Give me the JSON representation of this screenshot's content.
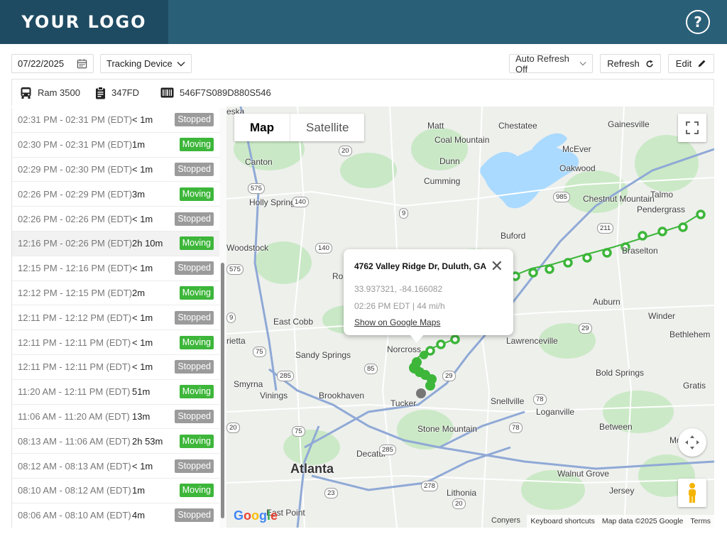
{
  "header": {
    "logo": "YOUR LOGO",
    "help_icon": "question-circle-icon",
    "help_label": "?"
  },
  "toolbar": {
    "date": "07/22/2025",
    "date_icon": "calendar-icon",
    "device": "Tracking Device",
    "auto_refresh": "Auto Refresh Off",
    "refresh_label": "Refresh",
    "edit_label": "Edit"
  },
  "vehicle": {
    "name": "Ram 3500",
    "plate": "347FD",
    "vin": "546F7S089D880S546"
  },
  "trips": [
    {
      "time": "02:31 PM - 02:31 PM (EDT)",
      "duration": "< 1m",
      "status": "Stopped"
    },
    {
      "time": "02:30 PM - 02:31 PM (EDT)",
      "duration": "1m",
      "status": "Moving"
    },
    {
      "time": "02:29 PM - 02:30 PM (EDT)",
      "duration": "< 1m",
      "status": "Stopped"
    },
    {
      "time": "02:26 PM - 02:29 PM (EDT)",
      "duration": "3m",
      "status": "Moving"
    },
    {
      "time": "02:26 PM - 02:26 PM (EDT)",
      "duration": "< 1m",
      "status": "Stopped"
    },
    {
      "time": "12:16 PM - 02:26 PM (EDT)",
      "duration": "2h 10m",
      "status": "Moving"
    },
    {
      "time": "12:15 PM - 12:16 PM (EDT)",
      "duration": "< 1m",
      "status": "Stopped"
    },
    {
      "time": "12:12 PM - 12:15 PM (EDT)",
      "duration": "2m",
      "status": "Moving"
    },
    {
      "time": "12:11 PM - 12:12 PM (EDT)",
      "duration": "< 1m",
      "status": "Stopped"
    },
    {
      "time": "12:11 PM - 12:11 PM (EDT)",
      "duration": "< 1m",
      "status": "Moving"
    },
    {
      "time": "12:11 PM - 12:11 PM (EDT)",
      "duration": "< 1m",
      "status": "Stopped"
    },
    {
      "time": "11:20 AM - 12:11 PM (EDT)",
      "duration": "51m",
      "status": "Moving"
    },
    {
      "time": "11:06 AM - 11:20 AM (EDT)",
      "duration": "13m",
      "status": "Stopped"
    },
    {
      "time": "08:13 AM - 11:06 AM (EDT)",
      "duration": "2h 53m",
      "status": "Moving"
    },
    {
      "time": "08:12 AM - 08:13 AM (EDT)",
      "duration": "< 1m",
      "status": "Stopped"
    },
    {
      "time": "08:10 AM - 08:12 AM (EDT)",
      "duration": "1m",
      "status": "Moving"
    },
    {
      "time": "08:06 AM - 08:10 AM (EDT)",
      "duration": "4m",
      "status": "Stopped"
    }
  ],
  "map": {
    "type_map": "Map",
    "type_satellite": "Satellite",
    "places": [
      "eska",
      "Gainesville",
      "Matt",
      "Chestatee",
      "Coal Mountain",
      "Canton",
      "McEver",
      "Dunn",
      "Oakwood",
      "Cumming",
      "Holly Springs",
      "Chestnut Mountain",
      "Talmo",
      "Pendergrass",
      "Buford",
      "Woodstock",
      "Braselton",
      "Roswell",
      "Auburn",
      "East Cobb",
      "Winder",
      "rietta",
      "Lawrenceville",
      "Bethlehem",
      "Sandy Springs",
      "Norcross",
      "Smyrna",
      "Bold Springs",
      "Vinings",
      "Brookhaven",
      "Tucker",
      "Snellville",
      "Gratis",
      "Loganville",
      "Stone Mountain",
      "Between",
      "Monroe",
      "Decatur",
      "Atlanta",
      "Walnut Grove",
      "Jersey",
      "Lithonia",
      "East Point",
      "Conyers"
    ],
    "routes": [
      "20",
      "575",
      "140",
      "9",
      "985",
      "211",
      "140",
      "575",
      "9",
      "29",
      "75",
      "285",
      "85",
      "29",
      "20",
      "78",
      "78",
      "75",
      "285",
      "20",
      "23",
      "278",
      "20"
    ],
    "popup": {
      "address": "4762 Valley Ridge Dr, Duluth, GA",
      "coords": "33.937321, -84.166082",
      "meta": "02:26 PM EDT | 44 mi/h",
      "link": "Show on Google Maps"
    },
    "google_logo": "Google",
    "attribution_left": "Conyers",
    "keyboard": "Keyboard shortcuts",
    "map_data": "Map data ©2025 Google",
    "terms": "Terms",
    "colors": {
      "water": "#aadaff",
      "land": "#eef0ec",
      "green": "#c6e8c2",
      "route": "#3db63a",
      "highway": "#8fa9d6"
    }
  }
}
